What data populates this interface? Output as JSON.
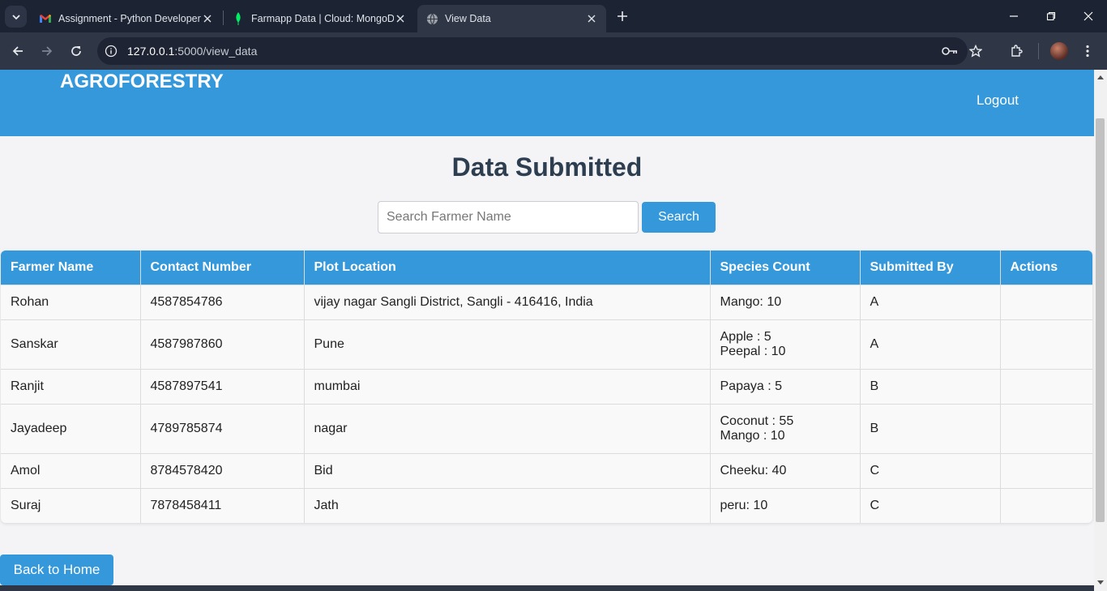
{
  "browser": {
    "tabs": [
      {
        "title": "Assignment - Python Developer",
        "icon": "gmail-icon"
      },
      {
        "title": "Farmapp Data | Cloud: MongoDB",
        "icon": "mongodb-leaf-icon"
      },
      {
        "title": "View Data",
        "icon": "globe-icon"
      }
    ],
    "url_host": "127.0.0.1",
    "url_path": ":5000/view_data"
  },
  "header": {
    "brand": "AGROFORESTRY",
    "logout_label": "Logout"
  },
  "main": {
    "title": "Data Submitted",
    "search_placeholder": "Search Farmer Name",
    "search_button": "Search",
    "back_button": "Back to Home"
  },
  "table": {
    "headers": [
      "Farmer Name",
      "Contact Number",
      "Plot Location",
      "Species Count",
      "Submitted By",
      "Actions"
    ],
    "rows": [
      {
        "name": "Rohan",
        "contact": "4587854786",
        "location": "vijay nagar Sangli District, Sangli - 416416, India",
        "species": [
          "Mango: 10"
        ],
        "by": "A",
        "actions": ""
      },
      {
        "name": "Sanskar",
        "contact": "4587987860",
        "location": "Pune",
        "species": [
          "Apple : 5",
          "Peepal : 10"
        ],
        "by": "A",
        "actions": ""
      },
      {
        "name": "Ranjit",
        "contact": "4587897541",
        "location": "mumbai",
        "species": [
          "Papaya : 5"
        ],
        "by": "B",
        "actions": ""
      },
      {
        "name": "Jayadeep",
        "contact": "4789785874",
        "location": "nagar",
        "species": [
          "Coconut : 55",
          "Mango : 10"
        ],
        "by": "B",
        "actions": ""
      },
      {
        "name": "Amol",
        "contact": "8784578420",
        "location": "Bid",
        "species": [
          "Cheeku: 40"
        ],
        "by": "C",
        "actions": ""
      },
      {
        "name": "Suraj",
        "contact": "7878458411",
        "location": "Jath",
        "species": [
          "peru: 10"
        ],
        "by": "C",
        "actions": ""
      }
    ]
  },
  "colors": {
    "accent": "#3498db",
    "title": "#2c3e50",
    "chrome_dark": "#1c2333",
    "chrome_toolbar": "#2f3646"
  }
}
